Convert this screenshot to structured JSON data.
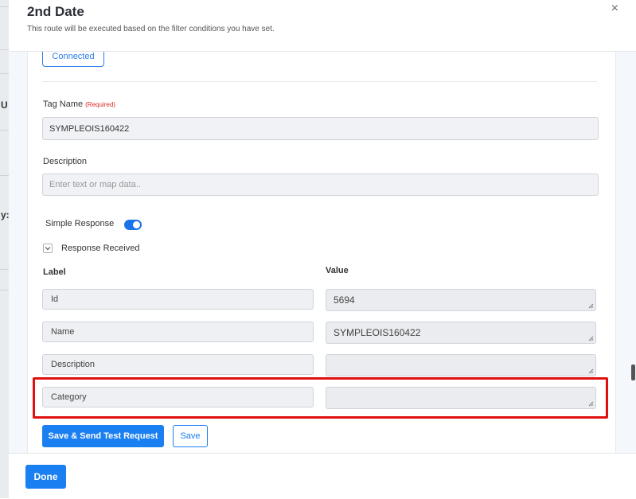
{
  "background": {
    "fragments": [
      "U",
      "y:"
    ]
  },
  "modal": {
    "title": "2nd Date",
    "subtitle": "This route will be executed based on the filter conditions you have set.",
    "close_label": "×"
  },
  "connection": {
    "button_label": "Connected"
  },
  "tag_name": {
    "label": "Tag Name",
    "required": "(Required)",
    "value": "SYMPLEOIS160422"
  },
  "description": {
    "label": "Description",
    "placeholder": "Enter text or map data.."
  },
  "simple_response": {
    "label": "Simple Response",
    "enabled": true
  },
  "response_received": {
    "label": "Response Received"
  },
  "table": {
    "label_header": "Label",
    "value_header": "Value",
    "rows": [
      {
        "label": "Id",
        "value": "5694"
      },
      {
        "label": "Name",
        "value": "SYMPLEOIS160422"
      },
      {
        "label": "Description",
        "value": ""
      },
      {
        "label": "Category",
        "value": ""
      }
    ]
  },
  "actions": {
    "save_test_label": "Save & Send Test Request",
    "save_label": "Save"
  },
  "footer": {
    "done_label": "Done"
  },
  "colors": {
    "accent": "#1a7ff0",
    "highlight": "#e01010"
  }
}
